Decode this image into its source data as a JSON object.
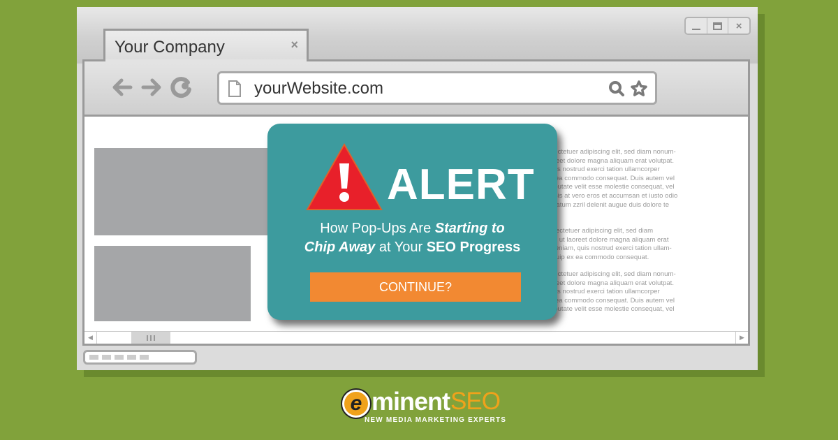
{
  "window": {
    "controls": {
      "minimize": "minimize",
      "maximize": "maximize",
      "close": "×"
    }
  },
  "tab": {
    "title": "Your Company",
    "close": "×"
  },
  "address_bar": {
    "url": "yourWebsite.com"
  },
  "icons": {
    "back": "arrow-left-icon",
    "forward": "arrow-right-icon",
    "reload": "reload-icon",
    "page": "page-icon",
    "search": "search-icon",
    "bookmark": "star-icon"
  },
  "content": {
    "paragraphs": [
      [
        "t amet, consectetuer adipiscing elit, sed diam nonum-",
        "cidunt ut laoreet dolore magna aliquam erat volutpat.",
        "n veniam, quis nostrud exerci tation ullamcorper",
        "ut aliquip ex ea commodo consequat. Duis autem vel",
        "ndrerit in vulputate velit esse molestie consequat, vel",
        "at nulla facilisis at vero eros et accumsan et iusto odio",
        " praesent luptatum zzril delenit augue duis dolore te"
      ],
      [
        "t amet, cons ectetuer adipiscing elit, sed diam",
        "mod tincidunt ut laoreet dolore magna aliquam erat",
        "s ad minim veniam, quis nostrud exerci tation ullam-",
        "tis nisl ut aliquip ex ea commodo consequat."
      ],
      [
        "t amet, consectetuer adipiscing elit, sed diam nonum-",
        "cidunt ut laoreet dolore magna aliquam erat volutpat.",
        "n veniam, quis nostrud exerci tation ullamcorper",
        "ut aliquip ex ea commodo consequat. Duis autem vel",
        "ndrerit in vulputate velit esse molestie consequat, vel"
      ]
    ]
  },
  "scrollbar": {
    "left_arrow": "◀",
    "right_arrow": "▶"
  },
  "popup": {
    "title": "ALERT",
    "headline": {
      "part1": "How Pop-Ups Are ",
      "part2": "Starting to",
      "part3": "Chip Away",
      "part4": " at Your ",
      "part5": "SEO Progress"
    },
    "button": "CONTINUE?",
    "colors": {
      "background": "#3d9b9e",
      "button": "#f28932",
      "warning": "#e8202a"
    }
  },
  "logo": {
    "badge": "e",
    "word": "minent",
    "seo": "SEO",
    "tagline": "NEW MEDIA MARKETING EXPERTS"
  },
  "colors": {
    "background": "#81a23b"
  }
}
